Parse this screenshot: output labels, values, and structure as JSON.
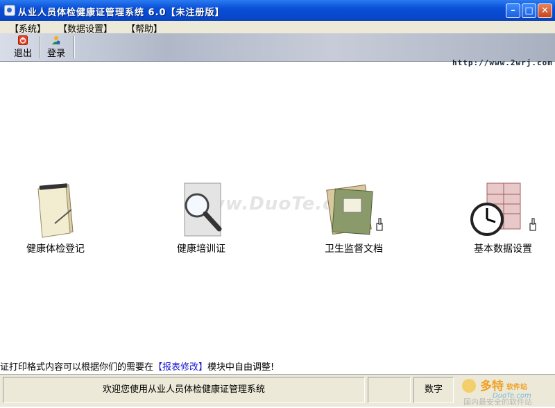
{
  "window": {
    "title": "从业人员体检健康证管理系统 6.0【未注册版】",
    "minimize": "–",
    "maximize": "□",
    "close": "✕"
  },
  "menu": [
    "【系统】",
    "【数据设置】",
    "【帮助】"
  ],
  "toolbar": {
    "exit_label": "退出",
    "login_label": "登录"
  },
  "url": "http://www.2wrj.com",
  "watermark": "www.DuoTe.com",
  "modules": [
    {
      "label": "健康体检登记",
      "icon": "notepad-icon"
    },
    {
      "label": "健康培训证",
      "icon": "magnifier-icon"
    },
    {
      "label": "卫生监督文档",
      "icon": "documents-icon"
    },
    {
      "label": "基本数据设置",
      "icon": "clock-table-icon"
    }
  ],
  "tip": {
    "prefix": "证打印格式内容可以根据你们的需要在",
    "highlight": "【报表修改】",
    "suffix": "模块中自由调整!"
  },
  "status": {
    "welcome": "欢迎您使用从业人员体检健康证管理系统",
    "numlock": "数字"
  },
  "footer_logo": {
    "brand": "多特",
    "brand_suffix": "软件站",
    "site": "DuoTe.com",
    "slogan": "国内最安全的软件站"
  },
  "colors": {
    "titlebar": "#0a4fd8",
    "tip_highlight": "#1a1ad0",
    "logo_orange": "#f0a020"
  }
}
